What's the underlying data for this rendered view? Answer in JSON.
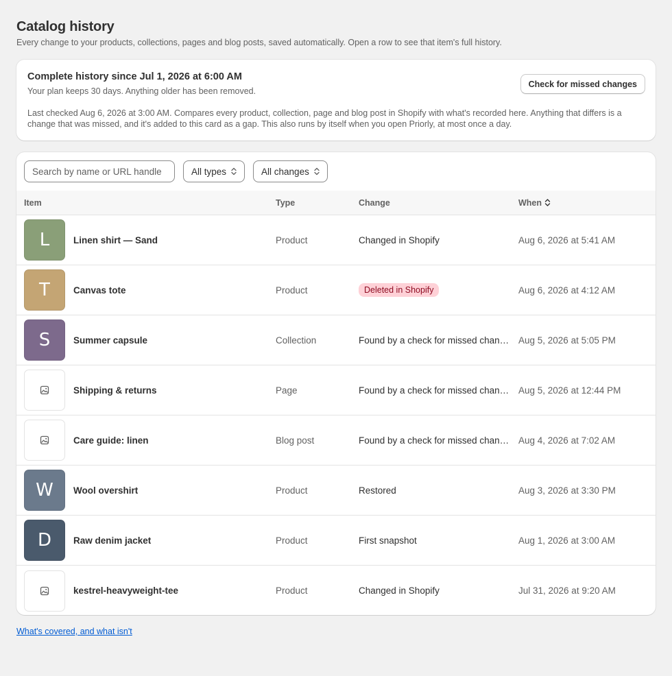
{
  "header": {
    "title": "Catalog history",
    "subtitle": "Every change to your products, collections, pages and blog posts, saved automatically. Open a row to see that item's full history."
  },
  "history_card": {
    "title": "Complete history since Jul 1, 2026 at 6:00 AM",
    "plan_note": "Your plan keeps 30 days. Anything older has been removed.",
    "description": "Last checked Aug 6, 2026 at 3:00 AM. Compares every product, collection, page and blog post in Shopify with what's recorded here. Anything that differs is a change that was missed, and it's added to this card as a gap. This also runs by itself when you open Priorly, at most once a day.",
    "check_button": "Check for missed changes"
  },
  "filters": {
    "search_placeholder": "Search by name or URL handle",
    "type_filter": "All types",
    "change_filter": "All changes"
  },
  "table": {
    "columns": {
      "item": "Item",
      "type": "Type",
      "change": "Change",
      "when": "When"
    },
    "rows": [
      {
        "thumb": "L",
        "thumb_color": "#8a9f78",
        "name": "Linen shirt — Sand",
        "type": "Product",
        "change": "Changed in Shopify",
        "when": "Aug 6, 2026 at 5:41 AM",
        "badge": false
      },
      {
        "thumb": "T",
        "thumb_color": "#c4a574",
        "name": "Canvas tote",
        "type": "Product",
        "change": "Deleted in Shopify",
        "when": "Aug 6, 2026 at 4:12 AM",
        "badge": true
      },
      {
        "thumb": "S",
        "thumb_color": "#7d6a8c",
        "name": "Summer capsule",
        "type": "Collection",
        "change": "Found by a check for missed changes",
        "when": "Aug 5, 2026 at 5:05 PM",
        "badge": false
      },
      {
        "thumb": "",
        "thumb_color": "#ffffff",
        "name": "Shipping & returns",
        "type": "Page",
        "change": "Found by a check for missed changes",
        "when": "Aug 5, 2026 at 12:44 PM",
        "badge": false
      },
      {
        "thumb": "",
        "thumb_color": "#ffffff",
        "name": "Care guide: linen",
        "type": "Blog post",
        "change": "Found by a check for missed changes",
        "when": "Aug 4, 2026 at 7:02 AM",
        "badge": false
      },
      {
        "thumb": "W",
        "thumb_color": "#6b7a8c",
        "name": "Wool overshirt",
        "type": "Product",
        "change": "Restored",
        "when": "Aug 3, 2026 at 3:30 PM",
        "badge": false
      },
      {
        "thumb": "D",
        "thumb_color": "#4a5a6c",
        "name": "Raw denim jacket",
        "type": "Product",
        "change": "First snapshot",
        "when": "Aug 1, 2026 at 3:00 AM",
        "badge": false
      },
      {
        "thumb": "",
        "thumb_color": "#ffffff",
        "name": "kestrel-heavyweight-tee",
        "type": "Product",
        "change": "Changed in Shopify",
        "when": "Jul 31, 2026 at 9:20 AM",
        "badge": false
      }
    ]
  },
  "footer": {
    "link": "What's covered, and what isn't"
  },
  "colors": {
    "accent": "#005bd3",
    "badge_bg": "#fed1d7",
    "badge_text": "#8e0b21"
  }
}
